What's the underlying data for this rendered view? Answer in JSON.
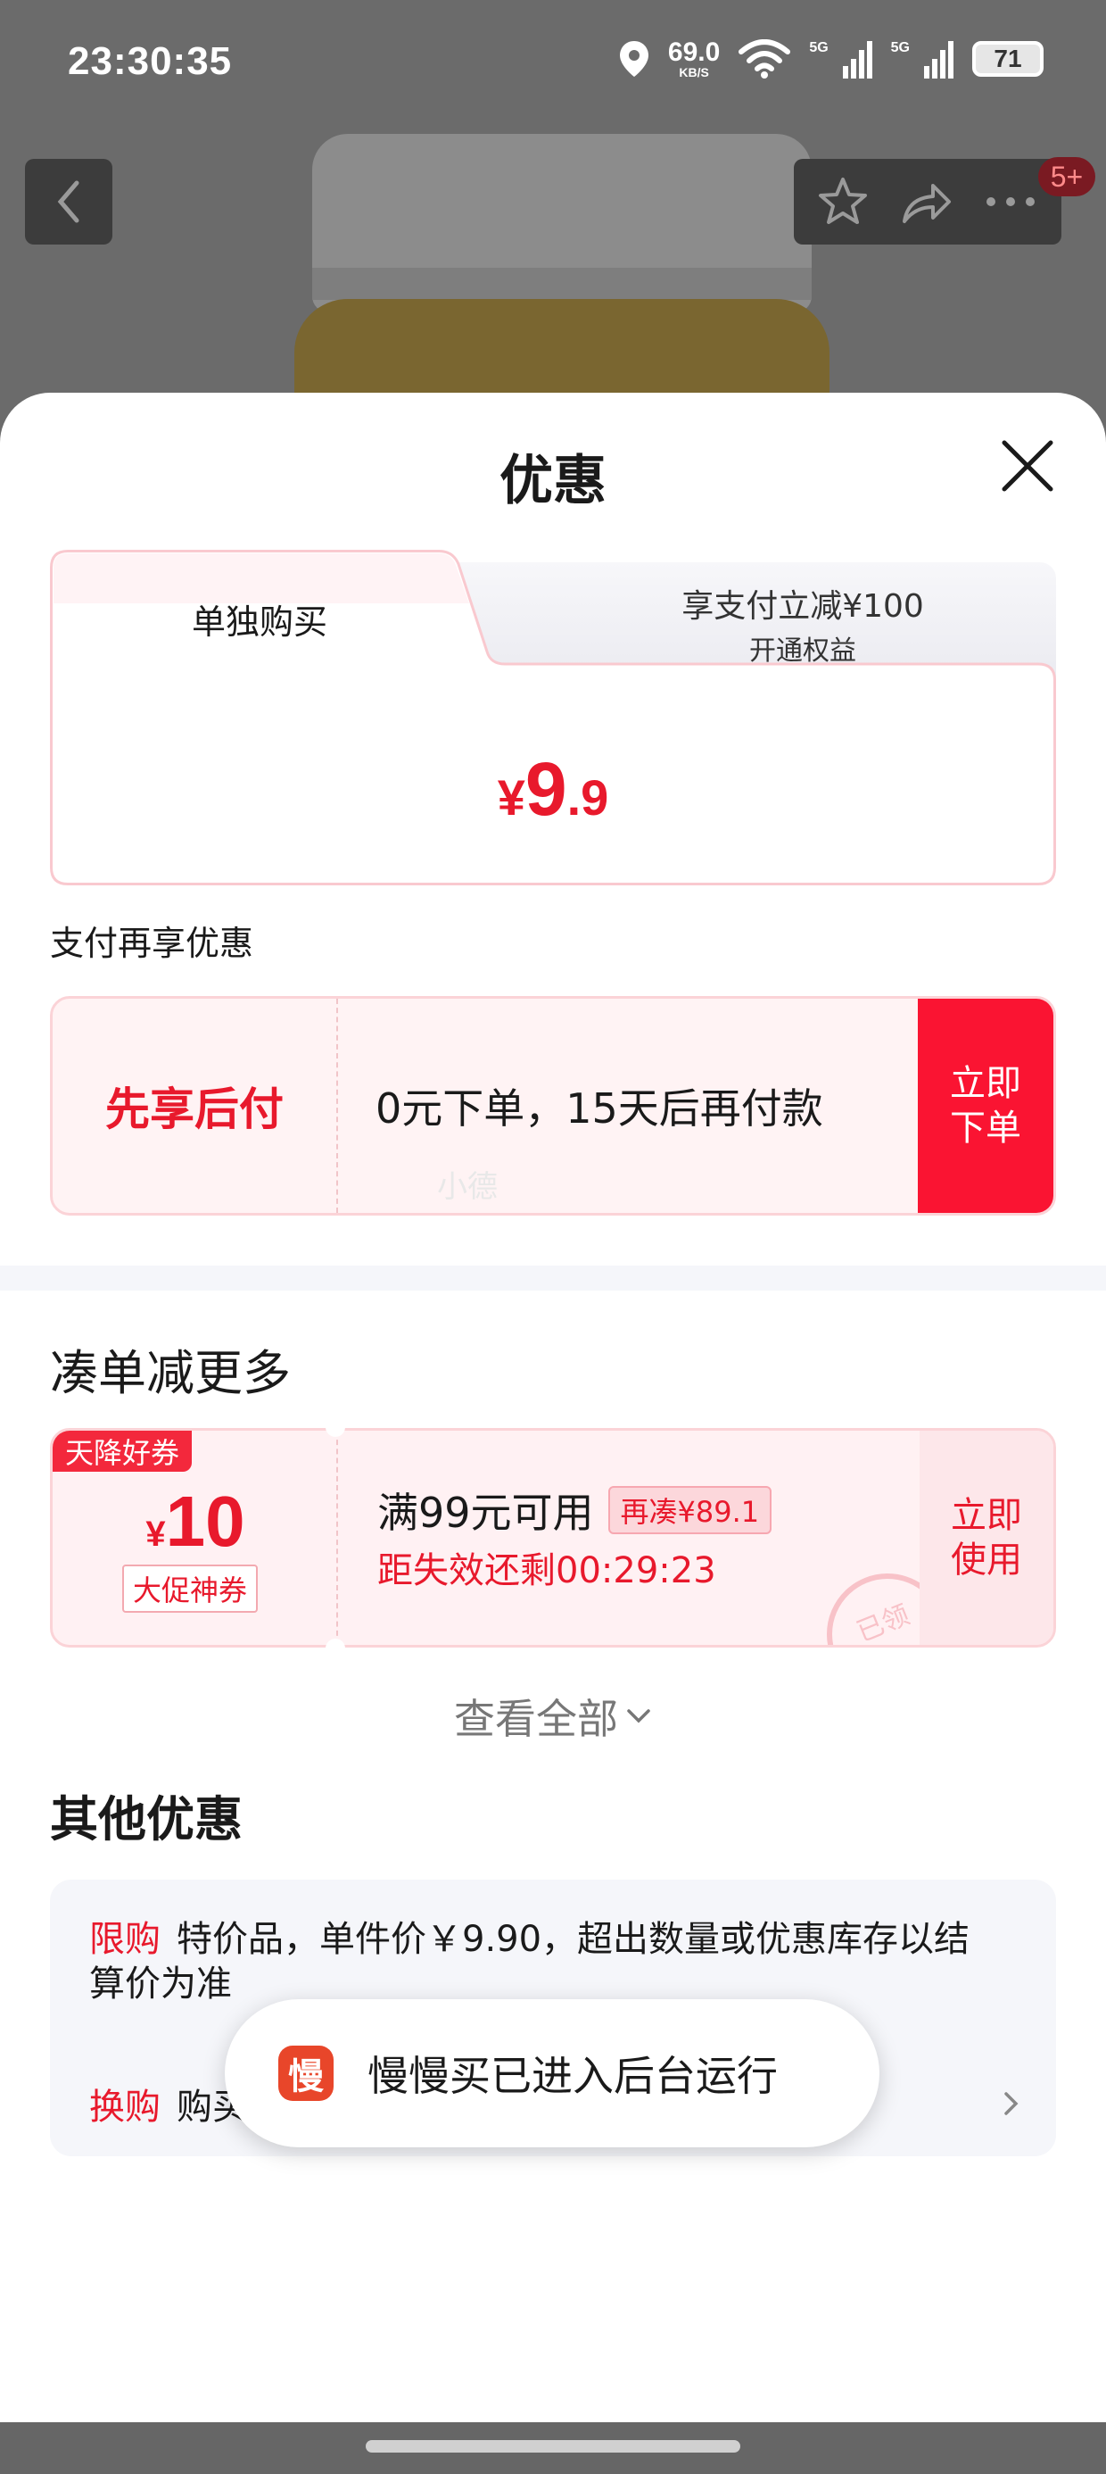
{
  "status_bar": {
    "time": "23:30:35",
    "net_speed_value": "69.0",
    "net_speed_unit": "KB/S",
    "signal_label_1": "5G",
    "signal_label_2": "5G",
    "battery": "71"
  },
  "header": {
    "badge": "5+"
  },
  "sheet": {
    "title": "优惠",
    "tabs": {
      "left_label": "单独购买",
      "right_main": "享支付立减¥100",
      "right_sub": "开通权益"
    },
    "price": {
      "symbol": "¥",
      "integer": "9",
      "decimal": ".9"
    },
    "pay_section_label": "支付再享优惠",
    "pay_later": {
      "title": "先享后付",
      "description": "0元下单，15天后再付款",
      "button_line1": "立即",
      "button_line2": "下单",
      "watermark": "小德"
    },
    "more_section_title": "凑单减更多",
    "coupon": {
      "tag": "天降好券",
      "symbol": "¥",
      "amount": "10",
      "kind": "大促神券",
      "condition": "满99元可用",
      "chip": "再凑¥89.1",
      "countdown": "距失效还剩00:29:23",
      "button_line1": "立即",
      "button_line2": "使用",
      "stamp": "已领"
    },
    "view_all": "查看全部",
    "other_section_title": "其他优惠",
    "other_offers": [
      {
        "key": "限购",
        "text": "特价品，单件价￥9.90，超出数量或优惠库存以结算价为准"
      },
      {
        "key": "换购",
        "text": "购买"
      }
    ]
  },
  "toast": {
    "icon_char": "慢",
    "text": "慢慢买已进入后台运行"
  },
  "colors": {
    "accent_red": "#e8192c",
    "button_red": "#fa1432",
    "coupon_bg": "#fff1f3"
  }
}
